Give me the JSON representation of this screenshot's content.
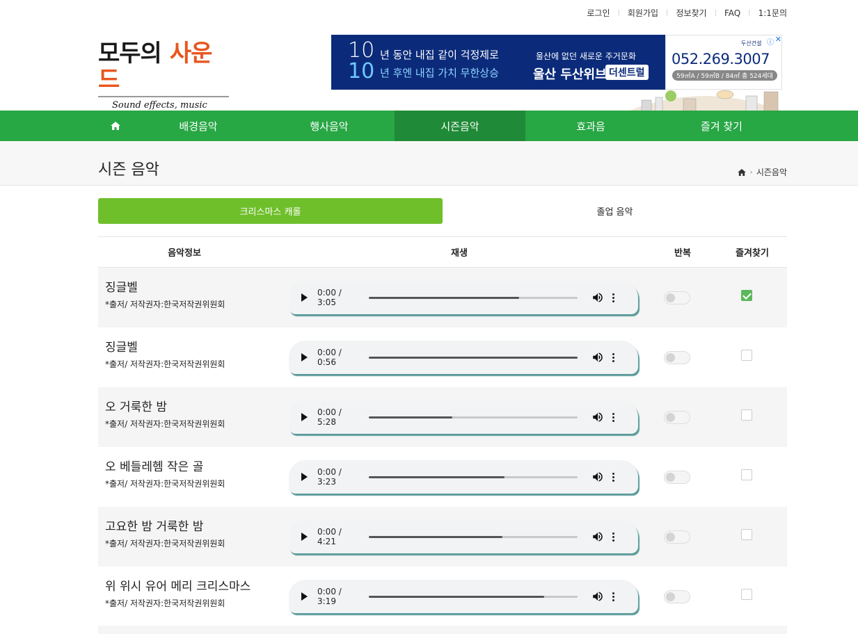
{
  "topnav": {
    "login": "로그인",
    "signup": "회원가입",
    "find_info": "정보찾기",
    "faq": "FAQ",
    "inquiry": "1:1문의"
  },
  "logo": {
    "line1a": "모두의",
    "line1b": "사운드",
    "line2": "Sound effects, music"
  },
  "ad": {
    "num_top": "10",
    "num_bottom": "10",
    "line1": "년 동안 내집 같이 걱정제로",
    "line2": "년 후엔 내집 가치 무한상승",
    "sub": "울산에 없던 새로운 주거문화",
    "title": "울산 두산위브",
    "badge": "더센트럴",
    "phone": "052.269.3007",
    "spec": "59㎡A / 59㎡B / 84㎡ 총 524세대",
    "brand": "두산건설"
  },
  "mainnav": {
    "items": [
      {
        "label": "배경음악"
      },
      {
        "label": "행사음악"
      },
      {
        "label": "시즌음악"
      },
      {
        "label": "효과음"
      },
      {
        "label": "즐겨 찾기"
      }
    ]
  },
  "page": {
    "title": "시즌 음악",
    "breadcrumb": "시즌음악"
  },
  "tabs": [
    {
      "label": "크리스마스 캐롤",
      "active": true
    },
    {
      "label": "졸업 음악",
      "active": false
    }
  ],
  "table": {
    "headers": {
      "info": "음악정보",
      "play": "재생",
      "repeat": "반복",
      "favorite": "즐겨찾기"
    },
    "rows": [
      {
        "name": "징글벨",
        "source": "*출저/ 저작권자:한국저작권위원회",
        "time": "0:00 / 3:05",
        "progress": 0.72,
        "repeat": false,
        "favorite": true
      },
      {
        "name": "징글벨",
        "source": "*출저/ 저작권자:한국저작권위원회",
        "time": "0:00 / 0:56",
        "progress": 1.0,
        "repeat": false,
        "favorite": false
      },
      {
        "name": "오 거룩한 밤",
        "source": "*출저/ 저작권자:한국저작권위원회",
        "time": "0:00 / 5:28",
        "progress": 0.4,
        "repeat": false,
        "favorite": false
      },
      {
        "name": "오 베들레헴 작은 골",
        "source": "*출저/ 저작권자:한국저작권위원회",
        "time": "0:00 / 3:23",
        "progress": 0.65,
        "repeat": false,
        "favorite": false
      },
      {
        "name": "고요한 밤 거룩한 밤",
        "source": "*출저/ 저작권자:한국저작권위원회",
        "time": "0:00 / 4:21",
        "progress": 0.64,
        "repeat": false,
        "favorite": false
      },
      {
        "name": "위 위시 유어 메리 크리스마스",
        "source": "*출저/ 저작권자:한국저작권위원회",
        "time": "0:00 / 3:19",
        "progress": 0.84,
        "repeat": false,
        "favorite": false
      }
    ]
  },
  "colors": {
    "nav_green": "#28a745",
    "nav_active": "#1f8a37",
    "tab_active": "#6fbf2b",
    "logo_orange": "#e8561e",
    "ad_navy": "#0b2b7a"
  }
}
